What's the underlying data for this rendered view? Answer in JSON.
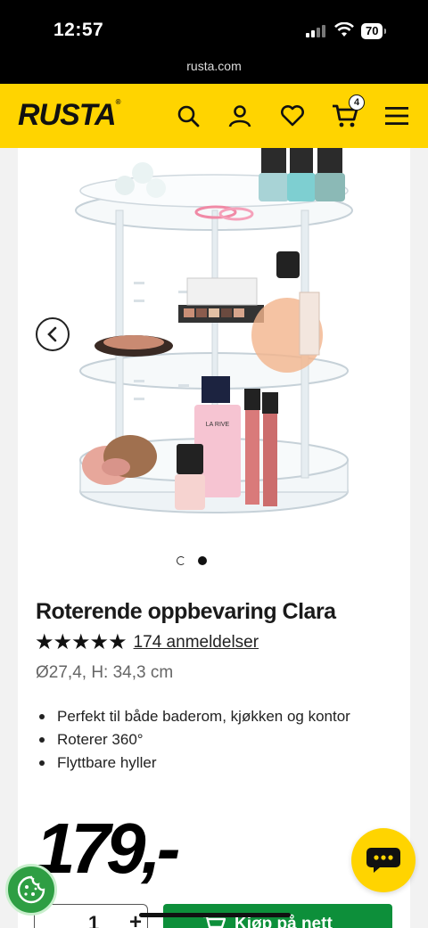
{
  "status_bar": {
    "time": "12:57",
    "battery": "70",
    "url": "rusta.com"
  },
  "header": {
    "logo": "RUSTA",
    "cart_count": "4"
  },
  "product": {
    "image_alt": "Roterende oppbevaring Clara",
    "title": "Roterende oppbevaring Clara",
    "stars": "★★★★★",
    "rating_value": 5,
    "reviews": "174 anmeldelser",
    "dimensions": "Ø27,4, H: 34,3 cm",
    "features": [
      "Perfekt til både baderom, kjøkken og kontor",
      "Roterer 360°",
      "Flyttbare hyller"
    ],
    "price": "179,-",
    "quantity": "1",
    "buy_label": "Kjøp på nett"
  },
  "carousel": {
    "slides": 2,
    "active": 2
  },
  "colors": {
    "brand_yellow": "#ffd400",
    "buy_green": "#0d8f3a",
    "cookie_green": "#2e9e43"
  }
}
